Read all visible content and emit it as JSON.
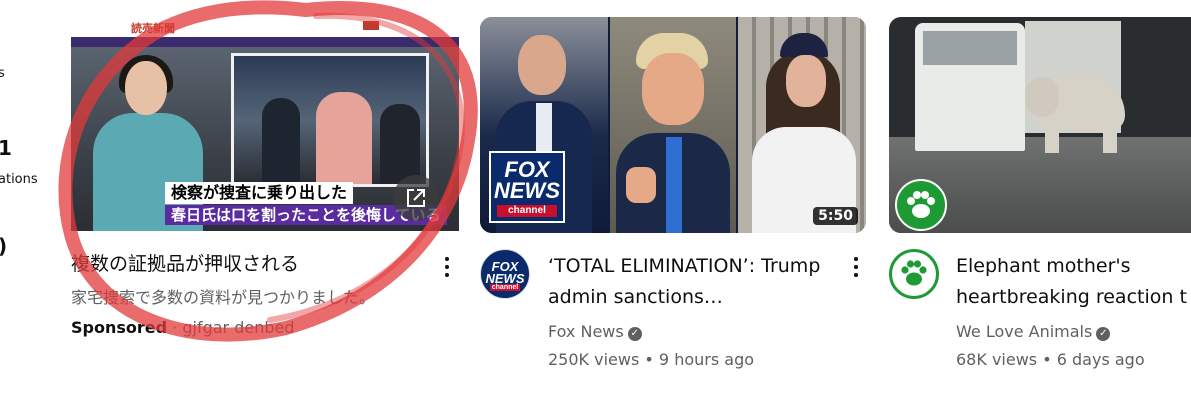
{
  "sidebar_peek": {
    "items": [
      "s",
      "ations"
    ]
  },
  "sponsored_card": {
    "thumbnail": {
      "site_logo": "読売新聞",
      "caption_line1": "検察が捜査に乗り出した",
      "caption_line2": "春日氏は口を割ったことを後悔している"
    },
    "title": "複数の証拠品が押収される",
    "description": "家宅捜索で多数の資料が見つかりました。",
    "sponsored_label": "Sponsored",
    "separator": "·",
    "advertiser": "gjfgar denbed"
  },
  "fox_card": {
    "thumbnail": {
      "logo_line1": "FOX",
      "logo_line2": "NEWS",
      "logo_line3": "channel",
      "duration": "5:50"
    },
    "avatar": {
      "line1": "FOX",
      "line2": "NEWS",
      "line3": "channel"
    },
    "title": "‘TOTAL ELIMINATION’: Trump admin sanctions…",
    "channel": "Fox News",
    "views": "250K views",
    "separator": "•",
    "age": "9 hours ago"
  },
  "elephant_card": {
    "title": "Elephant mother's heartbreaking reaction t",
    "channel": "We Love Animals",
    "views": "68K views",
    "separator": "•",
    "age": "6 days ago"
  },
  "colors": {
    "fox_navy": "#0a2a6b",
    "fox_red": "#c8102e",
    "paw_green": "#1e9a35",
    "annotation_red": "#e23a3a",
    "sponsored_purple": "#5a2ca0"
  },
  "icons": [
    "external-link-icon",
    "more-vert-icon",
    "verified-check-icon",
    "paw-icon"
  ]
}
